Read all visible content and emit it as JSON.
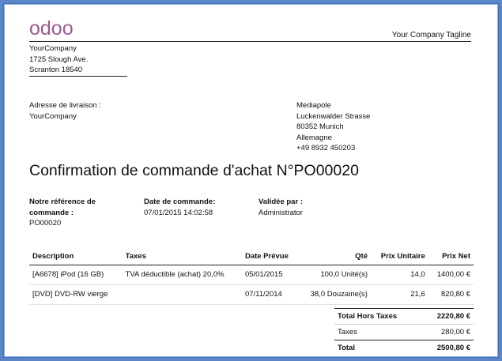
{
  "header": {
    "logo_text": "odoo",
    "tagline": "Your Company Tagline",
    "logo_color": "#9b5a8f"
  },
  "company": {
    "name": "YourCompany",
    "street": "1725 Slough Ave.",
    "city": "Scranton 18540"
  },
  "shipping": {
    "label": "Adresse de livraison :",
    "name": "YourCompany"
  },
  "vendor": {
    "name": "Mediapole",
    "street": "Luckenwalder Strasse",
    "city": "80352 Munich",
    "country": "Allemagne",
    "phone": "+49 8932 450203"
  },
  "title": "Confirmation de commande d'achat N°PO00020",
  "info": {
    "ref_label_1": "Notre référence de",
    "ref_label_2": "commande :",
    "ref_value": "PO00020",
    "date_label": "Date de commande:",
    "date_value": "07/01/2015 14:02:58",
    "validated_label": "Validée par :",
    "validated_value": "Administrator"
  },
  "table": {
    "headers": [
      "Description",
      "Taxes",
      "Date Prévue",
      "Qté",
      "Prix Unitaire",
      "Prix Net"
    ],
    "rows": [
      [
        "[A6678] iPod (16 GB)",
        "TVA déductible (achat) 20,0%",
        "05/01/2015",
        "100,0 Unité(s)",
        "14,0",
        "1400,00 €"
      ],
      [
        "[DVD] DVD-RW vierge",
        "",
        "07/11/2014",
        "38,0 Douzaine(s)",
        "21,6",
        "820,80 €"
      ]
    ]
  },
  "totals": {
    "subtotal_label": "Total Hors Taxes",
    "subtotal_value": "2220,80 €",
    "taxes_label": "Taxes",
    "taxes_value": "280,00 €",
    "total_label": "Total",
    "total_value": "2500,80 €"
  }
}
